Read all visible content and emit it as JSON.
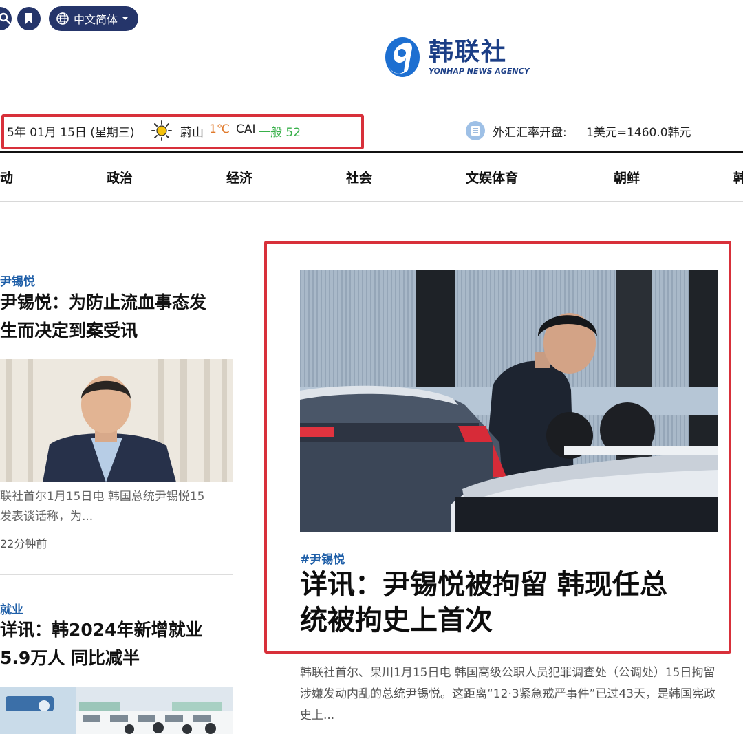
{
  "header": {
    "language_label": "中文简体",
    "logo_cn": "韩联社",
    "logo_en": "YONHAP NEWS AGENCY"
  },
  "info": {
    "date": "5年 01月 15日 (星期三)",
    "city": "蔚山",
    "temperature": "1℃",
    "cai_label": "CAI",
    "cai_value": "一般 52",
    "fx_label": "外汇汇率开盘:",
    "fx_value": "1美元=1460.0韩元"
  },
  "nav": {
    "items": [
      "动",
      "政治",
      "经济",
      "社会",
      "文娱体育",
      "朝鲜",
      "韩"
    ]
  },
  "left_articles": [
    {
      "tag": "尹锡悦",
      "title_line1": "尹锡悦：为防止流血事态发",
      "title_line2": "生而决定到案受讯",
      "summary_line1": "联社首尔1月15日电 韩国总统尹锡悦15",
      "summary_line2": "发表谈话称，为...",
      "time": "22分钟前"
    },
    {
      "tag": "就业",
      "title_line1": "详讯：韩2024年新增就业",
      "title_line2": "5.9万人 同比减半"
    }
  ],
  "featured": {
    "tag": "#尹锡悦",
    "title_line1": "详讯：尹锡悦被拘留 韩现任总",
    "title_line2": "统被拘史上首次",
    "summary": "韩联社首尔、果川1月15日电 韩国高级公职人员犯罪调查处（公调处）15日拘留涉嫌发动内乱的总统尹锡悦。这距离“12·3紧急戒严事件”已过43天，是韩国宪政史上..."
  },
  "colors": {
    "brand_navy": "#25356a",
    "logo_blue": "#1b3e86",
    "tag_blue": "#1f5fa8",
    "highlight_red": "#d8303a",
    "temp_orange": "#e07a2c",
    "cai_green": "#38b04a"
  },
  "icons": [
    "search-icon",
    "bookmark-icon",
    "globe-icon",
    "caret-down-icon",
    "sun-icon",
    "fx-icon"
  ]
}
